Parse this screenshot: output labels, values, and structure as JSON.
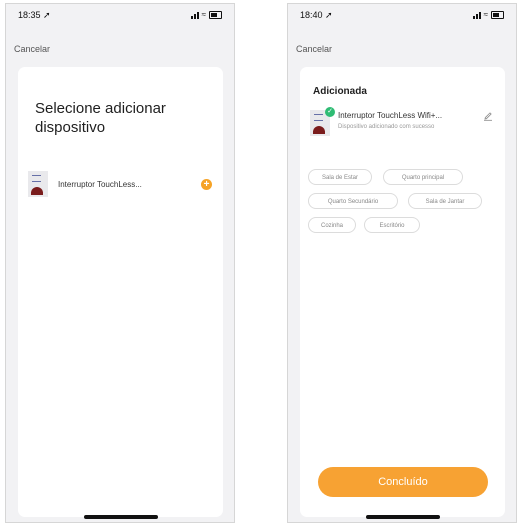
{
  "left": {
    "status_time": "18:35",
    "cancel_label": "Cancelar",
    "title": "Selecione adicionar dispositivo",
    "device_name": "Interruptor TouchLess...",
    "add_symbol": "+"
  },
  "right": {
    "status_time": "18:40",
    "cancel_label": "Cancelar",
    "section_title": "Adicionada",
    "device_name": "Interruptor TouchLess Wifi+...",
    "device_status": "Dispositivo adicionado com sucesso",
    "rooms": [
      "Sala de Estar",
      "Quarto principal",
      "Quarto Secundário",
      "Sala de Jantar",
      "Cozinha",
      "Escritório"
    ],
    "done_label": "Concluído"
  },
  "icons": [
    "signal-icon",
    "wifi-icon",
    "battery-icon",
    "location-arrow-icon",
    "plus-icon",
    "check-icon",
    "edit-icon"
  ],
  "colors": {
    "accent": "#f7a233",
    "success": "#2fbc74",
    "background": "#f2f2f4",
    "card": "#ffffff"
  }
}
